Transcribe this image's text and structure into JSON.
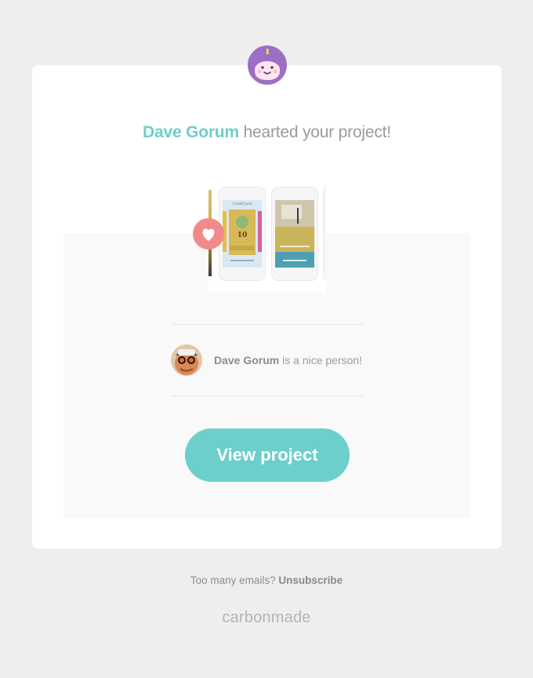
{
  "headline": {
    "name": "Dave Gorum",
    "action": " hearted your project!"
  },
  "colors": {
    "accent": "#6ccfcb",
    "heart": "#f08a8b",
    "mascot": "#9b6fc4"
  },
  "preview": {
    "phone1": {
      "app_name": "CashCard",
      "number": "10"
    },
    "phone2": {}
  },
  "note": {
    "name": "Dave Gorum",
    "text": " is a nice person!"
  },
  "cta": {
    "label": "View project"
  },
  "footer": {
    "prompt": "Too many emails? ",
    "unsubscribe": "Unsubscribe",
    "brand": "carbonmade"
  },
  "icons": {
    "mascot": "mascot-face-icon",
    "heart": "heart-icon"
  }
}
